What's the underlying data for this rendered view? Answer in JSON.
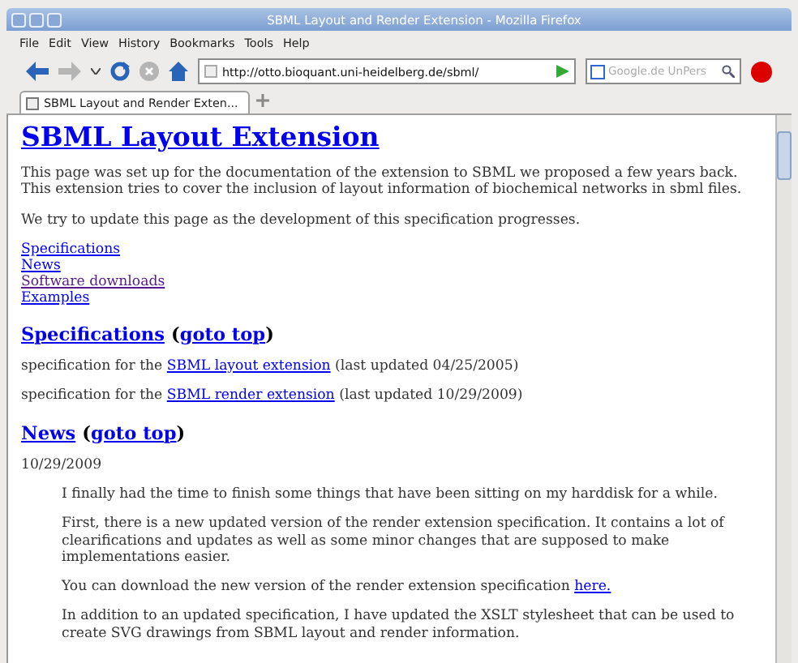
{
  "window": {
    "title": "SBML Layout and Render Extension - Mozilla Firefox"
  },
  "menu": [
    "File",
    "Edit",
    "View",
    "History",
    "Bookmarks",
    "Tools",
    "Help"
  ],
  "toolbar": {
    "buttons": [
      {
        "kind": "back",
        "disabled": false
      },
      {
        "kind": "forward",
        "disabled": true
      },
      {
        "kind": "reload",
        "disabled": false
      },
      {
        "kind": "stop",
        "disabled": true
      },
      {
        "kind": "home",
        "disabled": false
      }
    ],
    "url": "http://otto.bioquant.uni-heidelberg.de/sbml/",
    "search_placeholder": "Google.de UnPers"
  },
  "tabs": [
    {
      "label": "SBML Layout and Render Exten...",
      "selected": true
    }
  ],
  "page": {
    "title": "SBML Layout Extension",
    "intro": [
      "This page was set up for the documentation of the extension to SBML we proposed a few years back. This extension tries to cover the inclusion of layout information of biochemical networks in sbml files.",
      "We try to update this page as the development of this specification progresses."
    ],
    "toc": [
      {
        "label": "Specifications",
        "visited": false
      },
      {
        "label": "News",
        "visited": false
      },
      {
        "label": "Software downloads",
        "visited": true
      },
      {
        "label": "Examples",
        "visited": false
      }
    ],
    "sections": [
      {
        "heading": "Specifications",
        "open": "(",
        "top_link": "goto top",
        "close": ")",
        "paragraphs": [
          {
            "before": "specification for the ",
            "link": "SBML layout extension",
            "after": " (last updated 04/25/2005)"
          },
          {
            "before": "specification for the ",
            "link": "SBML render extension",
            "after": " (last updated 10/29/2009)"
          }
        ],
        "indented": false
      },
      {
        "heading": "News",
        "open": "(",
        "top_link": "goto top",
        "close": ")",
        "date": "10/29/2009",
        "indented": true,
        "paragraphs": [
          {
            "before": "I finally had the time to finish some things that have been sitting on my harddisk for a while."
          },
          {
            "before": "First, there is a new updated version of the render extension specification. It contains a lot of clearifications and updates as well as some minor changes that are supposed to make implementations easier."
          },
          {
            "before": "You can download the new version of the render extension specification ",
            "link": "here."
          },
          {
            "before": "In addition to an updated specification, I have updated the XSLT stylesheet that can be used to create SVG drawings from SBML layout and render information."
          }
        ]
      }
    ]
  }
}
